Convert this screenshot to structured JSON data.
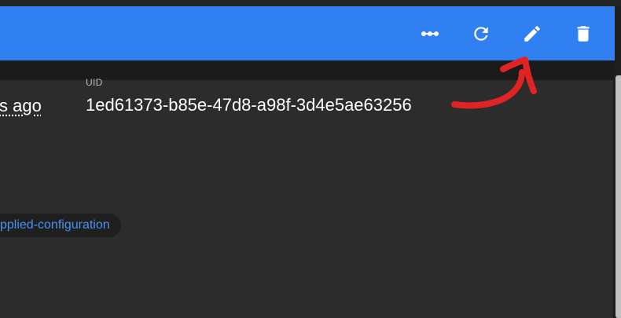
{
  "toolbar": {
    "actions": [
      {
        "icon": "more-horizontal-icon",
        "label": "More"
      },
      {
        "icon": "refresh-icon",
        "label": "Refresh"
      },
      {
        "icon": "pencil-icon",
        "label": "Edit"
      },
      {
        "icon": "trash-icon",
        "label": "Delete"
      }
    ],
    "color": "#3080f2"
  },
  "details": {
    "age_value": "s ago",
    "uid_label": "UID",
    "uid_value": "1ed61373-b85e-47d8-a98f-3d4e5ae63256"
  },
  "chip": {
    "text": "pplied-configuration"
  },
  "annotation": {
    "shape": "hand-drawn red arrow pointing to edit button",
    "color": "#e02424"
  }
}
